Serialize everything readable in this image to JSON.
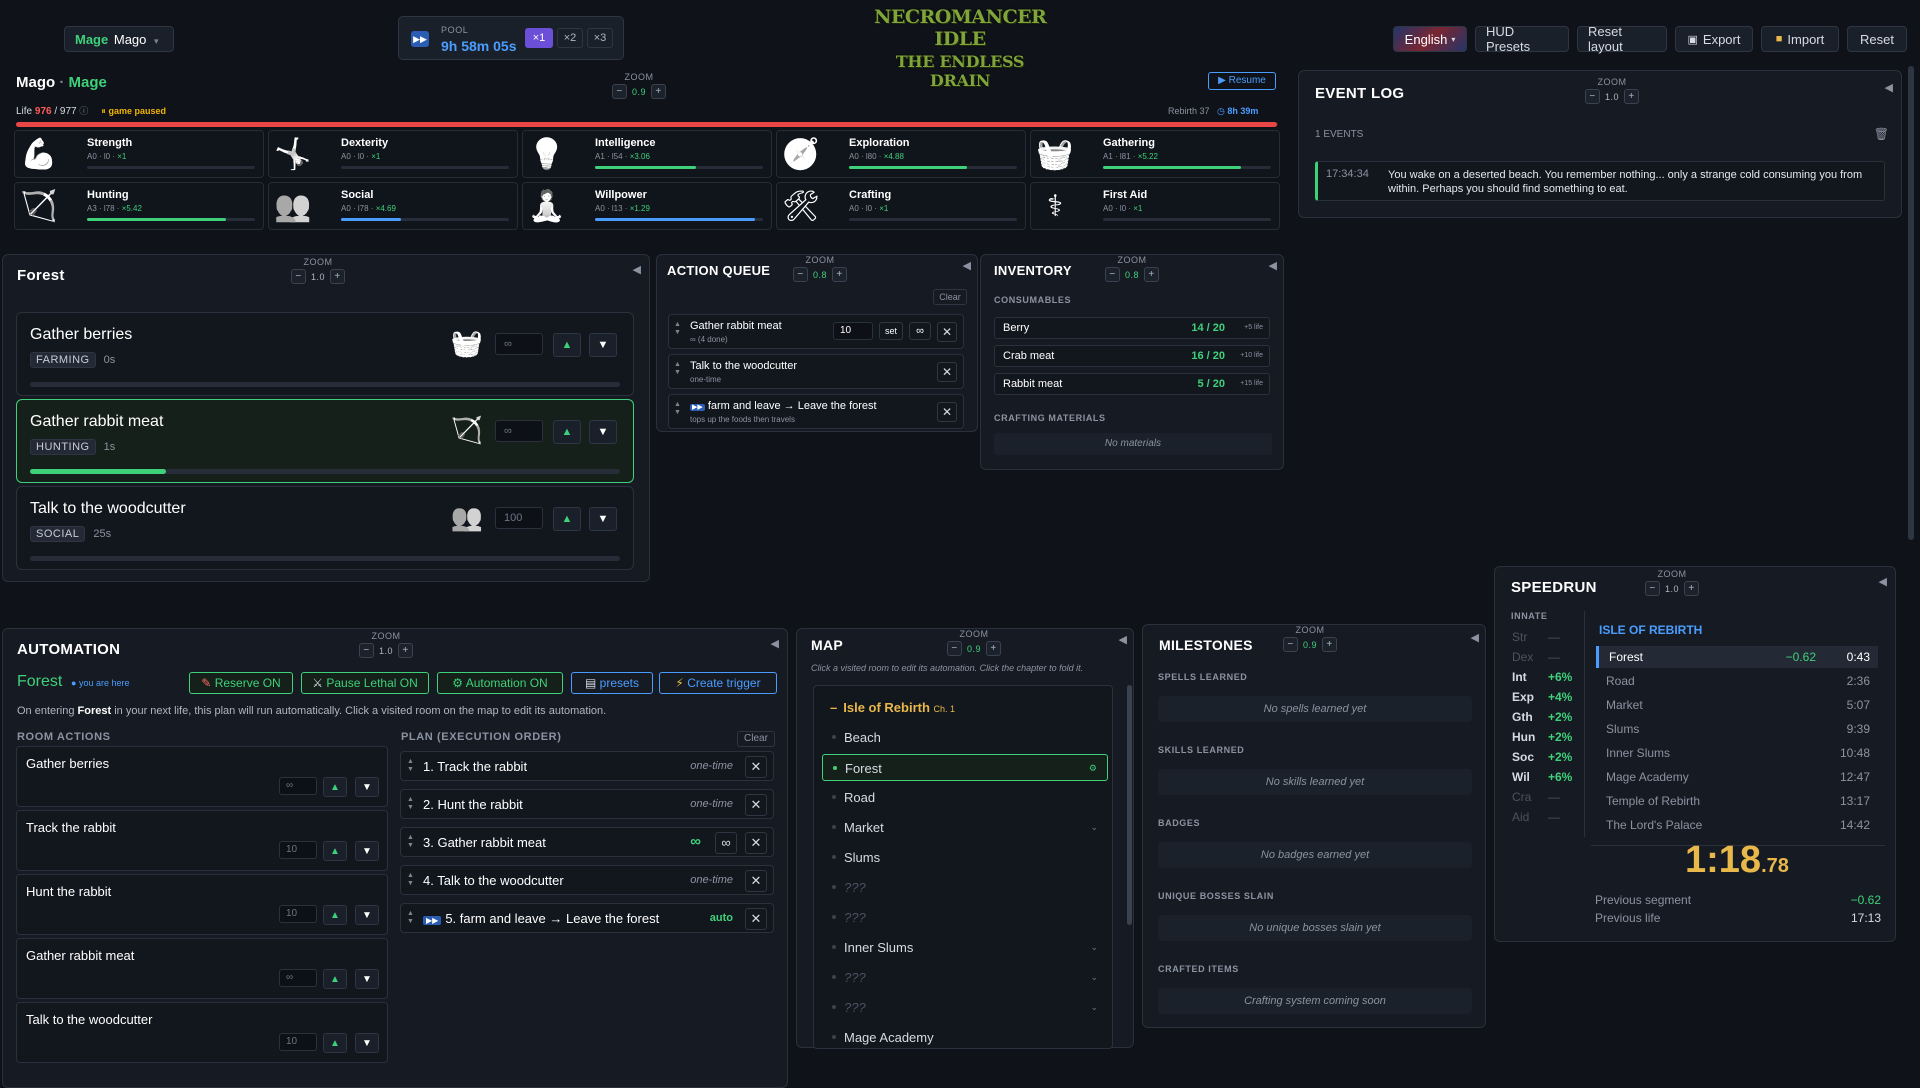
{
  "topbar": {
    "char_class": "Mage",
    "char_name": "Mago",
    "pool_label": "POOL",
    "pool_time": "9h 58m 05s",
    "speeds": [
      "×1",
      "×2",
      "×3"
    ],
    "logo_line1": "NECROMANCER IDLE",
    "logo_line2": "THE ENDLESS DRAIN",
    "language": "English",
    "buttons": {
      "hud": "HUD Presets",
      "reset_layout": "Reset layout",
      "export": "Export",
      "import": "Import",
      "reset": "Reset"
    }
  },
  "character": {
    "name": "Mago",
    "sep": "·",
    "cls": "Mage",
    "zoom_label": "ZOOM",
    "zoom": "0.9",
    "resume": "▶ Resume",
    "life_label": "Life",
    "life_cur": "976",
    "life_max": "/ 977",
    "paused": "game paused",
    "rebirth": "Rebirth 37",
    "rebirth_time": "8h 39m",
    "life_fraction": 0.999,
    "skills": [
      {
        "name": "Strength",
        "stats": "A0 · l0 · ",
        "mult": "×1",
        "progress": 0
      },
      {
        "name": "Dexterity",
        "stats": "A0 · l0 · ",
        "mult": "×1",
        "progress": 0
      },
      {
        "name": "Intelligence",
        "stats": "A1 · l54 · ",
        "mult": "×3.06",
        "progress": 0.6
      },
      {
        "name": "Exploration",
        "stats": "A0 · l80 · ",
        "mult": "×4.88",
        "progress": 0.7
      },
      {
        "name": "Gathering",
        "stats": "A1 · l81 · ",
        "mult": "×5.22",
        "progress": 0.82
      },
      {
        "name": "Hunting",
        "stats": "A3 · l78 · ",
        "mult": "×5.42",
        "progress": 0.83
      },
      {
        "name": "Social",
        "stats": "A0 · l78 · ",
        "mult": "×4.69",
        "progress": 0.36
      },
      {
        "name": "Willpower",
        "stats": "A0 · l13 · ",
        "mult": "×1.29",
        "progress": 0.95
      },
      {
        "name": "Crafting",
        "stats": "A0 · l0 · ",
        "mult": "×1",
        "progress": 0
      },
      {
        "name": "First Aid",
        "stats": "A0 · l0 · ",
        "mult": "×1",
        "progress": 0
      }
    ]
  },
  "event_log": {
    "title": "EVENT LOG",
    "zoom_label": "ZOOM",
    "zoom": "1.0",
    "count": "1 EVENTS",
    "events": [
      {
        "time": "17:34:34",
        "text": "You wake on a deserted beach. You remember nothing... only a strange cold consuming you from within. Perhaps you should find something to eat."
      }
    ]
  },
  "forest": {
    "title": "Forest",
    "zoom_label": "ZOOM",
    "zoom": "1.0",
    "actions": [
      {
        "name": "Gather berries",
        "tag": "FARMING",
        "time": "0s",
        "input": "∞",
        "progress": 0
      },
      {
        "name": "Gather rabbit meat",
        "tag": "HUNTING",
        "time": "1s",
        "input": "∞",
        "progress": 0.23
      },
      {
        "name": "Talk to the woodcutter",
        "tag": "SOCIAL",
        "time": "25s",
        "input": "100",
        "progress": 0
      }
    ]
  },
  "queue": {
    "title": "ACTION QUEUE",
    "zoom_label": "ZOOM",
    "zoom": "0.8",
    "clear": "Clear",
    "items": [
      {
        "name": "Gather rabbit meat",
        "sub": "∞ (4 done)",
        "count": "10",
        "set": "set",
        "inf": "∞"
      },
      {
        "name": "Talk to the woodcutter",
        "sub": "one-time"
      },
      {
        "name": "farm and leave → Leave the forest",
        "sub": "tops up the foods then travels"
      }
    ]
  },
  "inventory": {
    "title": "INVENTORY",
    "zoom_label": "ZOOM",
    "zoom": "0.8",
    "consumables_label": "CONSUMABLES",
    "items": [
      {
        "name": "Berry",
        "qty": "14 / 20",
        "life": "+5 life"
      },
      {
        "name": "Crab meat",
        "qty": "16 / 20",
        "life": "+10 life"
      },
      {
        "name": "Rabbit meat",
        "qty": "5 / 20",
        "life": "+15 life"
      }
    ],
    "materials_label": "CRAFTING MATERIALS",
    "no_materials": "No materials"
  },
  "speedrun": {
    "title": "SPEEDRUN",
    "zoom_label": "ZOOM",
    "zoom": "1.0",
    "innate_label": "INNATE",
    "innate": [
      {
        "label": "Str",
        "value": "—",
        "active": false
      },
      {
        "label": "Dex",
        "value": "—",
        "active": false
      },
      {
        "label": "Int",
        "value": "+6%",
        "active": true
      },
      {
        "label": "Exp",
        "value": "+4%",
        "active": true
      },
      {
        "label": "Gth",
        "value": "+2%",
        "active": true
      },
      {
        "label": "Hun",
        "value": "+2%",
        "active": true
      },
      {
        "label": "Soc",
        "value": "+2%",
        "active": true
      },
      {
        "label": "Wil",
        "value": "+6%",
        "active": true
      },
      {
        "label": "Cra",
        "value": "—",
        "active": false
      },
      {
        "label": "Aid",
        "value": "—",
        "active": false
      }
    ],
    "chapter": "ISLE OF REBIRTH",
    "segments": [
      {
        "name": "Forest",
        "delta": "−0.62",
        "time": "0:43"
      },
      {
        "name": "Road",
        "time": "2:36"
      },
      {
        "name": "Market",
        "time": "5:07"
      },
      {
        "name": "Slums",
        "time": "9:39"
      },
      {
        "name": "Inner Slums",
        "time": "10:48"
      },
      {
        "name": "Mage Academy",
        "time": "12:47"
      },
      {
        "name": "Temple of Rebirth",
        "time": "13:17"
      },
      {
        "name": "The Lord's Palace",
        "time": "14:42"
      }
    ],
    "timer_main": "1:18",
    "timer_frac": ".78",
    "prev_segment_label": "Previous segment",
    "prev_segment": "−0.62",
    "prev_life_label": "Previous life",
    "prev_life": "17:13"
  },
  "automation": {
    "title": "AUTOMATION",
    "zoom_label": "ZOOM",
    "zoom": "1.0",
    "room": "Forest",
    "here": "you are here",
    "buttons": {
      "reserve": "Reserve ON",
      "pause": "Pause Lethal ON",
      "auto": "Automation ON",
      "presets": "presets",
      "trigger": "Create trigger"
    },
    "info_pre": "On entering ",
    "info_room": "Forest",
    "info_post": " in your next life, this plan will run automatically. Click a visited room on the map to edit its automation.",
    "room_actions_label": "ROOM ACTIONS",
    "plan_label": "PLAN (EXECUTION ORDER)",
    "clear": "Clear",
    "room_actions": [
      {
        "name": "Gather berries",
        "input": "∞"
      },
      {
        "name": "Track the rabbit",
        "input": "10"
      },
      {
        "name": "Hunt the rabbit",
        "input": "10"
      },
      {
        "name": "Gather rabbit meat",
        "input": "∞"
      },
      {
        "name": "Talk to the woodcutter",
        "input": "10"
      }
    ],
    "plan": [
      {
        "name": "1. Track the rabbit",
        "type": "one-time"
      },
      {
        "name": "2. Hunt the rabbit",
        "type": "one-time"
      },
      {
        "name": "3. Gather rabbit meat",
        "type": "∞",
        "inf": "∞"
      },
      {
        "name": "4. Talk to the woodcutter",
        "type": "one-time"
      },
      {
        "name": "5. farm and leave → Leave the forest",
        "type": "auto"
      }
    ]
  },
  "map": {
    "title": "MAP",
    "zoom_label": "ZOOM",
    "zoom": "0.9",
    "hint": "Click a visited room to edit its automation. Click the chapter to fold it.",
    "chapter": "Isle of Rebirth",
    "chapter_tag": "Ch. 1",
    "rooms": [
      {
        "name": "Beach"
      },
      {
        "name": "Forest",
        "current": true
      },
      {
        "name": "Road"
      },
      {
        "name": "Market",
        "chev": "⌄"
      },
      {
        "name": "Slums"
      },
      {
        "name": "???",
        "unknown": true
      },
      {
        "name": "???",
        "unknown": true
      },
      {
        "name": "Inner Slums",
        "chev": "⌄"
      },
      {
        "name": "???",
        "unknown": true,
        "chev": "⌄"
      },
      {
        "name": "???",
        "unknown": true,
        "chev": "⌄"
      },
      {
        "name": "Mage Academy"
      }
    ]
  },
  "milestones": {
    "title": "MILESTONES",
    "zoom_label": "ZOOM",
    "zoom": "0.9",
    "sections": [
      {
        "label": "SPELLS LEARNED",
        "empty": "No spells learned yet"
      },
      {
        "label": "SKILLS LEARNED",
        "empty": "No skills learned yet"
      },
      {
        "label": "BADGES",
        "empty": "No badges earned yet"
      },
      {
        "label": "UNIQUE BOSSES SLAIN",
        "empty": "No unique bosses slain yet"
      },
      {
        "label": "CRAFTED ITEMS",
        "empty": "Crafting system coming soon"
      }
    ]
  }
}
